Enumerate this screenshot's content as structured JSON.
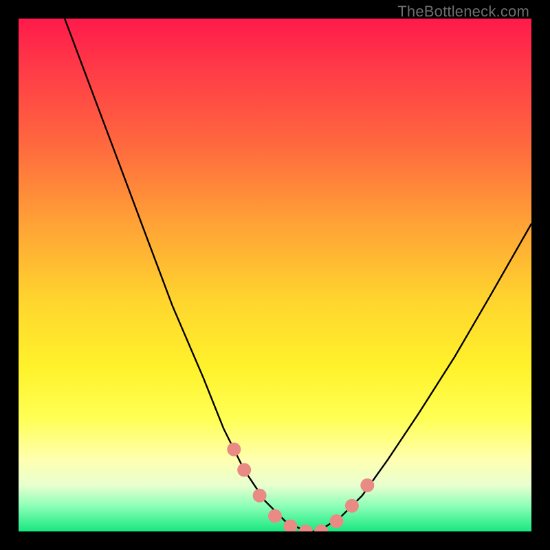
{
  "watermark": "TheBottleneck.com",
  "chart_data": {
    "type": "line",
    "title": "",
    "xlabel": "",
    "ylabel": "",
    "xlim": [
      0,
      100
    ],
    "ylim": [
      0,
      100
    ],
    "series": [
      {
        "name": "bottleneck-curve",
        "x": [
          9,
          12,
          15,
          18,
          21,
          24,
          27,
          30,
          33,
          36,
          38,
          40,
          42,
          44,
          46,
          48,
          50,
          52,
          54,
          56,
          58,
          60,
          63,
          67,
          72,
          78,
          85,
          92,
          100
        ],
        "y": [
          100,
          92,
          84,
          76,
          68,
          60,
          52,
          44,
          37,
          30,
          25,
          20,
          16,
          12,
          9,
          6,
          4,
          2,
          1,
          0,
          0,
          1,
          3,
          7,
          14,
          23,
          34,
          46,
          60
        ]
      }
    ],
    "markers": [
      {
        "name": "marker-a",
        "x": 42,
        "y": 16
      },
      {
        "name": "marker-b",
        "x": 44,
        "y": 12
      },
      {
        "name": "marker-c",
        "x": 47,
        "y": 7
      },
      {
        "name": "marker-d",
        "x": 50,
        "y": 3
      },
      {
        "name": "marker-e",
        "x": 53,
        "y": 1
      },
      {
        "name": "marker-f",
        "x": 56,
        "y": 0
      },
      {
        "name": "marker-g",
        "x": 59,
        "y": 0
      },
      {
        "name": "marker-h",
        "x": 62,
        "y": 2
      },
      {
        "name": "marker-i",
        "x": 65,
        "y": 5
      },
      {
        "name": "marker-j",
        "x": 68,
        "y": 9
      }
    ],
    "colors": {
      "curve": "#000000",
      "marker": "#e98a84"
    }
  }
}
